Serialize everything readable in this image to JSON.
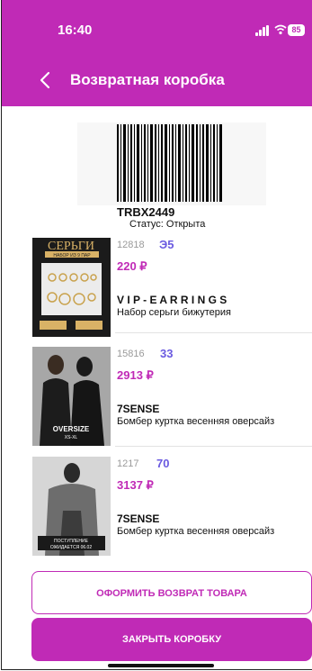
{
  "status_bar": {
    "time": "16:40",
    "battery": "85"
  },
  "header": {
    "title": "Возвратная коробка"
  },
  "box": {
    "code": "TRBX2449",
    "status": "Статус: Открыта"
  },
  "items": [
    {
      "sku": "12818",
      "qty": "Э5",
      "price": "220 ₽",
      "brand": "V I P - E A R R I N G S",
      "name": "Набор серьги бижутерия",
      "thumb_text": "СЕРЬГИ",
      "thumb_sub": "НАБОР ИЗ 9 ПАР"
    },
    {
      "sku": "15816",
      "qty": "33",
      "price": "2913 ₽",
      "brand": "7SENSE",
      "name": "Бомбер куртка весенняя оверсайз",
      "thumb_text": "OVERSIZE",
      "thumb_sub": "XS-XL"
    },
    {
      "sku": "1217",
      "qty": "70",
      "price": "3137 ₽",
      "brand": "7SENSE",
      "name": "Бомбер куртка весенняя оверсайз",
      "thumb_text": "ПОСТУПЛЕНИЕ",
      "thumb_sub": "ОЖИДАЕТСЯ 06.02"
    }
  ],
  "buttons": {
    "return": "ОФОРМИТЬ ВОЗВРАТ ТОВАРА",
    "close": "ЗАКРЫТЬ КОРОБКУ"
  },
  "colors": {
    "accent": "#c02ab6",
    "qty": "#6a5ae0",
    "sku": "#9a9a9a"
  }
}
